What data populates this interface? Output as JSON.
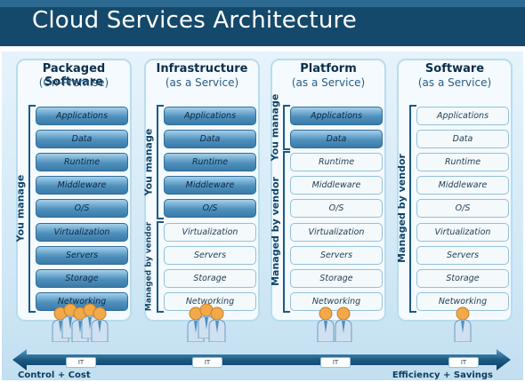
{
  "title": "Cloud Services Architecture",
  "layers": [
    "Applications",
    "Data",
    "Runtime",
    "Middleware",
    "O/S",
    "Virtualization",
    "Servers",
    "Storage",
    "Networking"
  ],
  "columns": [
    {
      "title": "Packaged Software",
      "subtitle": "(On-Premise)",
      "you_manage": 9,
      "labels": {
        "you": "You manage",
        "vendor": ""
      },
      "it_label": "IT",
      "people": 5
    },
    {
      "title": "Infrastructure",
      "subtitle": "(as a Service)",
      "you_manage": 5,
      "labels": {
        "you": "You manage",
        "vendor": "Managed by vendor"
      },
      "it_label": "IT",
      "people": 3
    },
    {
      "title": "Platform",
      "subtitle": "(as a Service)",
      "you_manage": 2,
      "labels": {
        "you": "You manage",
        "vendor": "Managed by vendor"
      },
      "it_label": "IT",
      "people": 2
    },
    {
      "title": "Software",
      "subtitle": "(as a Service)",
      "you_manage": 0,
      "labels": {
        "you": "",
        "vendor": "Managed by vendor"
      },
      "it_label": "IT",
      "people": 1
    }
  ],
  "footer": {
    "left": "Control + Cost",
    "right": "Efficiency + Savings"
  },
  "colors": {
    "title_bg": "#14496b",
    "you_layer": "#4f90bd",
    "vendor_layer": "#f4f9fc",
    "arrow": "#1c5a84"
  }
}
